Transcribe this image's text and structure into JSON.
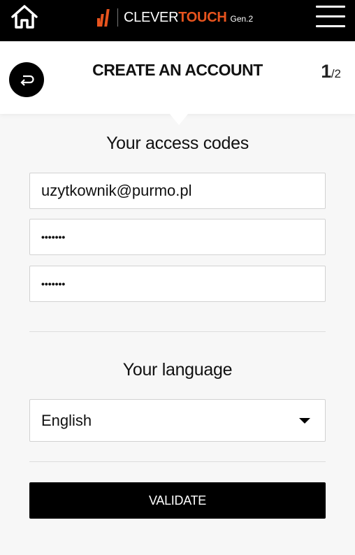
{
  "topbar": {
    "brand_prefix": "CLEVER",
    "brand_highlight": "TOUCH",
    "brand_suffix": "Gen.2",
    "home_icon": "home-icon",
    "menu_icon": "hamburger-menu-icon",
    "accent_color": "#e8541e"
  },
  "header": {
    "title": "CREATE AN ACCOUNT",
    "step_current": "1",
    "step_total": "/2",
    "back_icon": "back-arrow-icon"
  },
  "access": {
    "title": "Your access codes",
    "email_value": "uzytkownik@purmo.pl",
    "password_mask": "•••••••",
    "confirm_mask": "•••••••"
  },
  "language": {
    "title": "Your language",
    "selected": "English"
  },
  "actions": {
    "validate_label": "VALIDATE"
  }
}
